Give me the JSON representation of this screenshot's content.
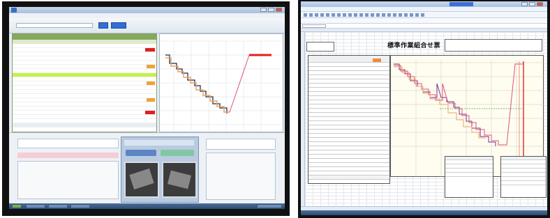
{
  "excel": {
    "sheet_title": "標準作業組合せ票",
    "colors": {
      "header_green": "#84a95a",
      "highlight_row": "#c6f04a",
      "flag_red": "#e02020",
      "flag_orange": "#f5a030",
      "line_purple": "#7b2c8f",
      "line_pink": "#e0507a",
      "line_navy": "#3d4f6e",
      "line_orange": "#f0a060",
      "vertical_red": "#e23030",
      "title_bar_blue": "#3d70d0"
    }
  }
}
